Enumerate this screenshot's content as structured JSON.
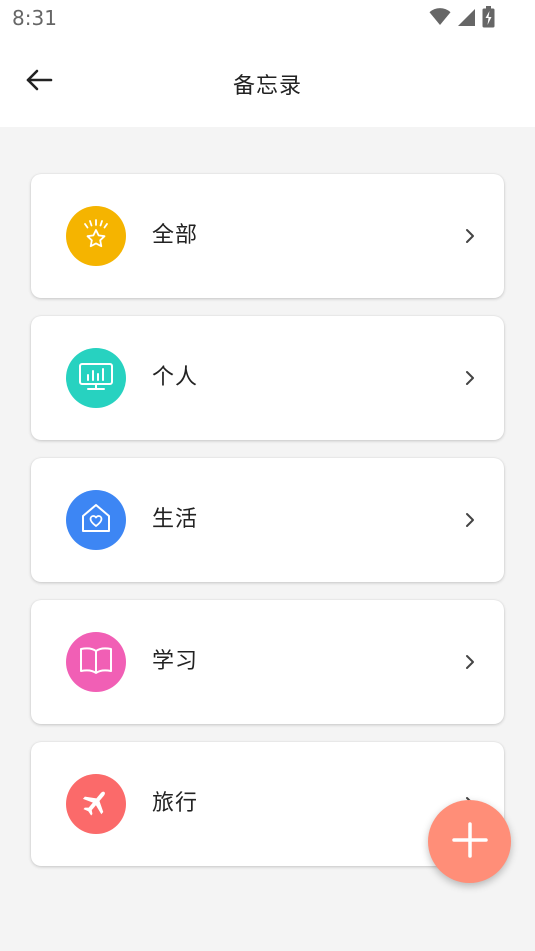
{
  "status_bar": {
    "time": "8:31"
  },
  "app_bar": {
    "title": "备忘录",
    "back_icon": "arrow-left-icon"
  },
  "categories": [
    {
      "label": "全部",
      "icon": "star-sparkle-icon",
      "color": "#f5b400"
    },
    {
      "label": "个人",
      "icon": "monitor-chart-icon",
      "color": "#27d2c0"
    },
    {
      "label": "生活",
      "icon": "house-heart-icon",
      "color": "#3d86f4"
    },
    {
      "label": "学习",
      "icon": "open-book-icon",
      "color": "#f15fb5"
    },
    {
      "label": "旅行",
      "icon": "airplane-icon",
      "color": "#fb6a6a"
    }
  ],
  "fab": {
    "icon": "plus-icon",
    "color": "#ff8e78"
  }
}
